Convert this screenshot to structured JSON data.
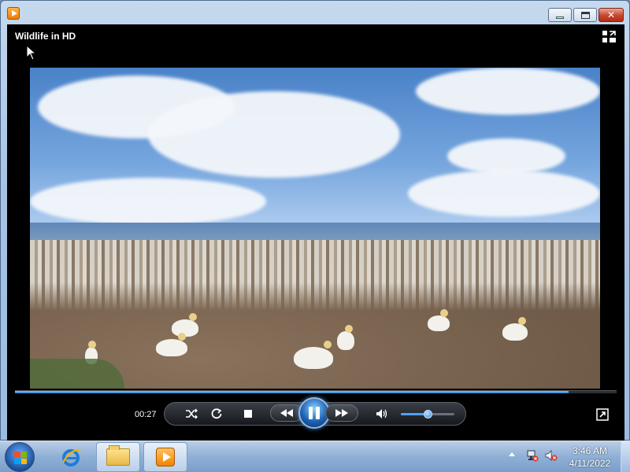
{
  "window": {
    "app_icon": "media-player-icon",
    "minimize_icon": "minimize-icon",
    "maximize_icon": "maximize-icon",
    "close_icon": "close-icon",
    "close_glyph": "✕"
  },
  "player": {
    "title": "Wildlife in HD",
    "switch_to_library_icon": "switch-to-library-icon",
    "video_description_icon": "video-frame"
  },
  "seek": {
    "progress": 0.92
  },
  "controls": {
    "elapsed_time": "00:27",
    "shuffle_icon": "shuffle-icon",
    "repeat_icon": "repeat-icon",
    "stop_icon": "stop-icon",
    "previous_icon": "rewind-icon",
    "play_pause_icon": "pause-icon",
    "next_icon": "fast-forward-icon",
    "mute_icon": "speaker-icon",
    "volume_level": 0.5,
    "fullscreen_icon": "fullscreen-icon"
  },
  "taskbar": {
    "start_icon": "windows-start-icon",
    "pinned": [
      "internet-explorer-icon",
      "file-explorer-icon",
      "windows-media-player-icon"
    ],
    "tray_icons": [
      "show-hidden-icons-icon",
      "network-icon",
      "volume-muted-icon"
    ],
    "clock_time": "3:46 AM",
    "clock_date": "4/11/2022"
  },
  "colors": {
    "accent": "#1d63b6",
    "flag_red": "#f25022",
    "flag_green": "#7fba00",
    "flag_blue": "#00a4ef",
    "flag_yellow": "#ffb900"
  }
}
